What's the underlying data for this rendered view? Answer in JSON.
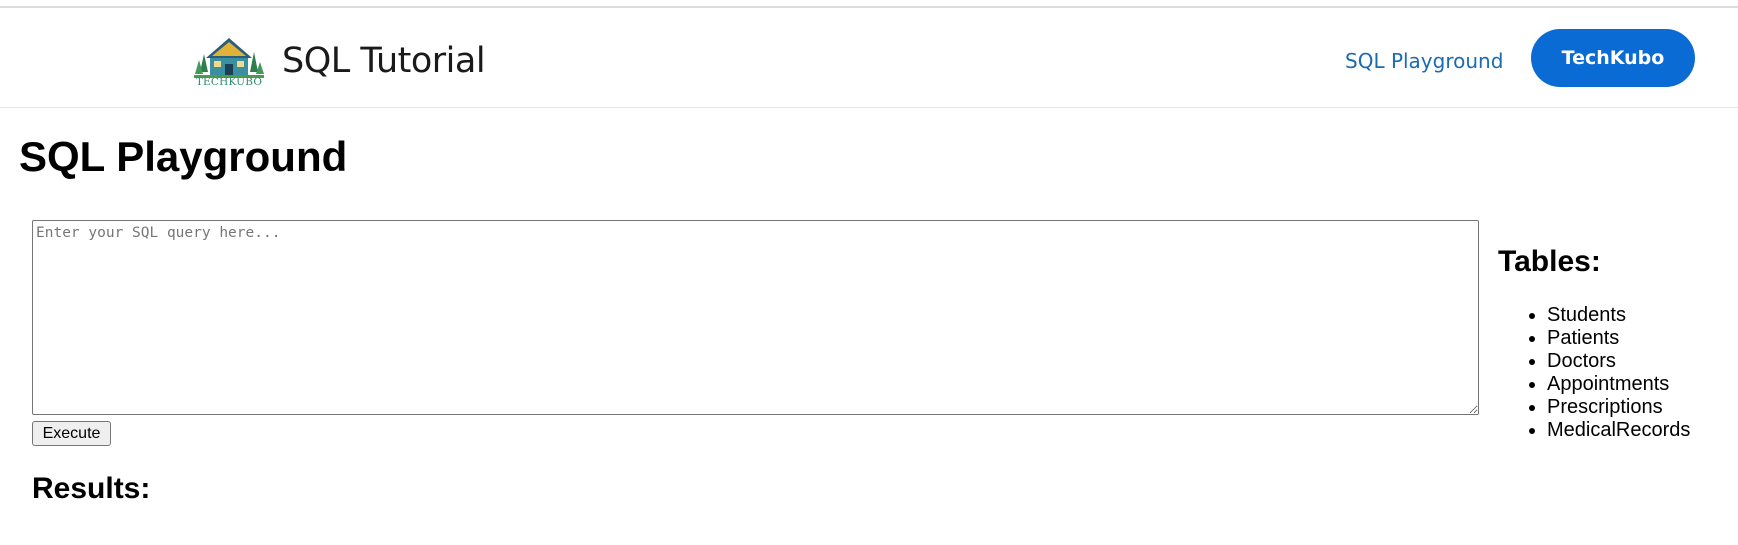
{
  "header": {
    "brand_title": "SQL Tutorial",
    "logo_text": "TECHKUBO",
    "nav_link_label": "SQL Playground",
    "nav_button_label": "TechKubo",
    "accent_color": "#0b6bd4",
    "link_color": "#1a6bb3"
  },
  "main": {
    "page_title": "SQL Playground",
    "query_placeholder": "Enter your SQL query here...",
    "query_value": "",
    "execute_label": "Execute",
    "results_heading": "Results:"
  },
  "sidebar": {
    "tables_heading": "Tables:",
    "tables": [
      "Students",
      "Patients",
      "Doctors",
      "Appointments",
      "Prescriptions",
      "MedicalRecords"
    ]
  }
}
